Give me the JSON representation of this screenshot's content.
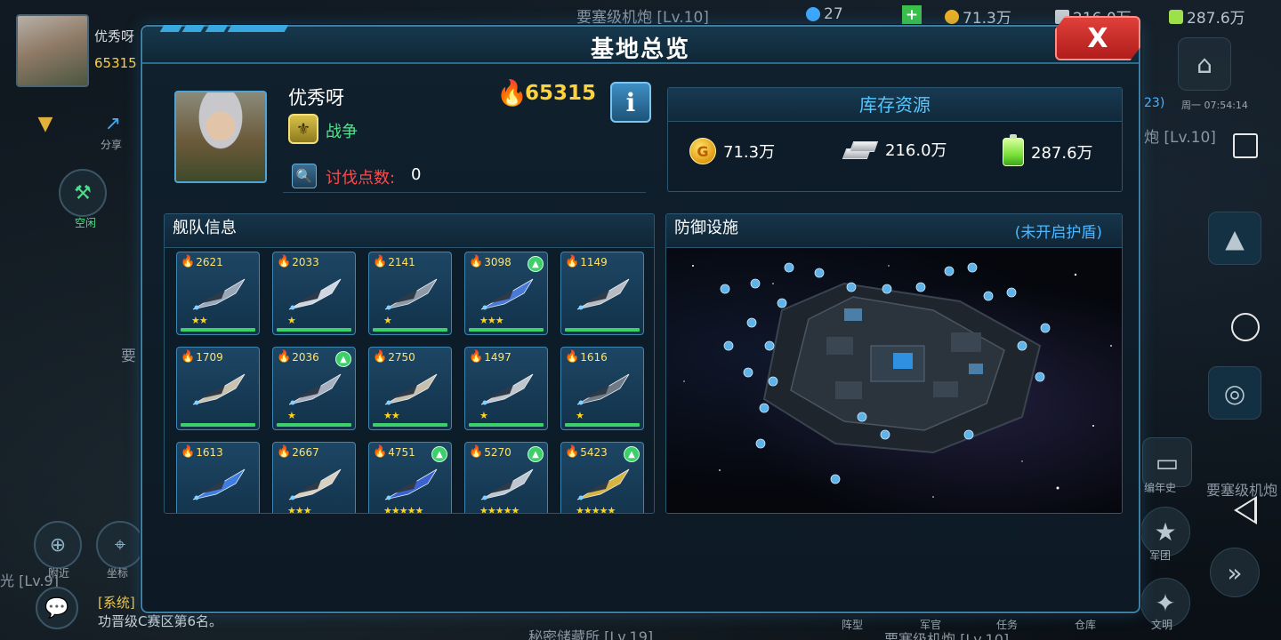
{
  "background": {
    "top_title": "要塞级机炮 [Lv.10]",
    "gems": "27",
    "gold_top": "71.3万",
    "metal_top": "216.0万",
    "energy_top": "287.6万",
    "player_name": "优秀呀",
    "player_power": "65315",
    "share_label": "分享",
    "idle_label": "空闲",
    "nearby_label": "附近",
    "coords_label": "坐标",
    "left_lv_text": "光 [Lv.9]",
    "left_mid_text": "要",
    "system_tag": "[系统]",
    "system_msg": "功晋级C赛区第6名。",
    "bottom_text": "秘密储藏所 [Lv.19]",
    "bottom_right_text": "要塞级机炮 [Lv.10]",
    "right_lv_text": "炮 [Lv.10]",
    "right_time": "周一 07:54:14",
    "right_count": "23)",
    "fort_right": "要塞级机炮",
    "history_label": "编年史",
    "legion_label": "军团",
    "civ_label": "文明",
    "formation_label": "阵型",
    "officer_label": "军官",
    "task_label": "任务",
    "warehouse_label": "仓库"
  },
  "dialog": {
    "title": "基地总览",
    "close_label": "X"
  },
  "player": {
    "name": "优秀呀",
    "faction": "战争",
    "conquest_label": "讨伐点数:",
    "conquest_value": "0",
    "power": "65315",
    "info_label": "i"
  },
  "storage": {
    "title": "库存资源",
    "gold": "71.3万",
    "metal": "216.0万",
    "energy": "287.6万",
    "gold_symbol": "G"
  },
  "fleet": {
    "title": "舰队信息",
    "ships": [
      {
        "power": "2621",
        "stars": "★★",
        "upgrade": false,
        "color": "#9aa7b8"
      },
      {
        "power": "2033",
        "stars": "★",
        "upgrade": false,
        "color": "#cfd6e0"
      },
      {
        "power": "2141",
        "stars": "★",
        "upgrade": false,
        "color": "#8f9aa6"
      },
      {
        "power": "3098",
        "stars": "★★★",
        "upgrade": true,
        "color": "#4a7ad8"
      },
      {
        "power": "1149",
        "stars": "",
        "upgrade": false,
        "color": "#b8bcc2"
      },
      {
        "power": "1709",
        "stars": "",
        "upgrade": false,
        "color": "#c9c2b0"
      },
      {
        "power": "2036",
        "stars": "★",
        "upgrade": true,
        "color": "#a8b0bf"
      },
      {
        "power": "2750",
        "stars": "★★",
        "upgrade": false,
        "color": "#c8c0ad"
      },
      {
        "power": "1497",
        "stars": "★",
        "upgrade": false,
        "color": "#bfc6cc"
      },
      {
        "power": "1616",
        "stars": "★",
        "upgrade": false,
        "color": "#6f7a86"
      },
      {
        "power": "1613",
        "stars": "",
        "upgrade": false,
        "color": "#3f7de0"
      },
      {
        "power": "2667",
        "stars": "★★★",
        "upgrade": false,
        "color": "#d8d0c0"
      },
      {
        "power": "4751",
        "stars": "★★★★★",
        "upgrade": true,
        "color": "#3a62d0"
      },
      {
        "power": "5270",
        "stars": "★★★★★",
        "upgrade": true,
        "color": "#c0c6d0"
      },
      {
        "power": "5423",
        "stars": "★★★★★",
        "upgrade": true,
        "color": "#d7b440"
      }
    ]
  },
  "defense": {
    "title": "防御设施",
    "shield_status": "(未开启护盾)"
  },
  "colors": {
    "accent": "#3e7ea3",
    "title_blue": "#58c6ff",
    "power_gold": "#ffd23c",
    "faction_green": "#56e08e",
    "alert_red": "#ff4a4a",
    "close_red": "#d0302c"
  }
}
